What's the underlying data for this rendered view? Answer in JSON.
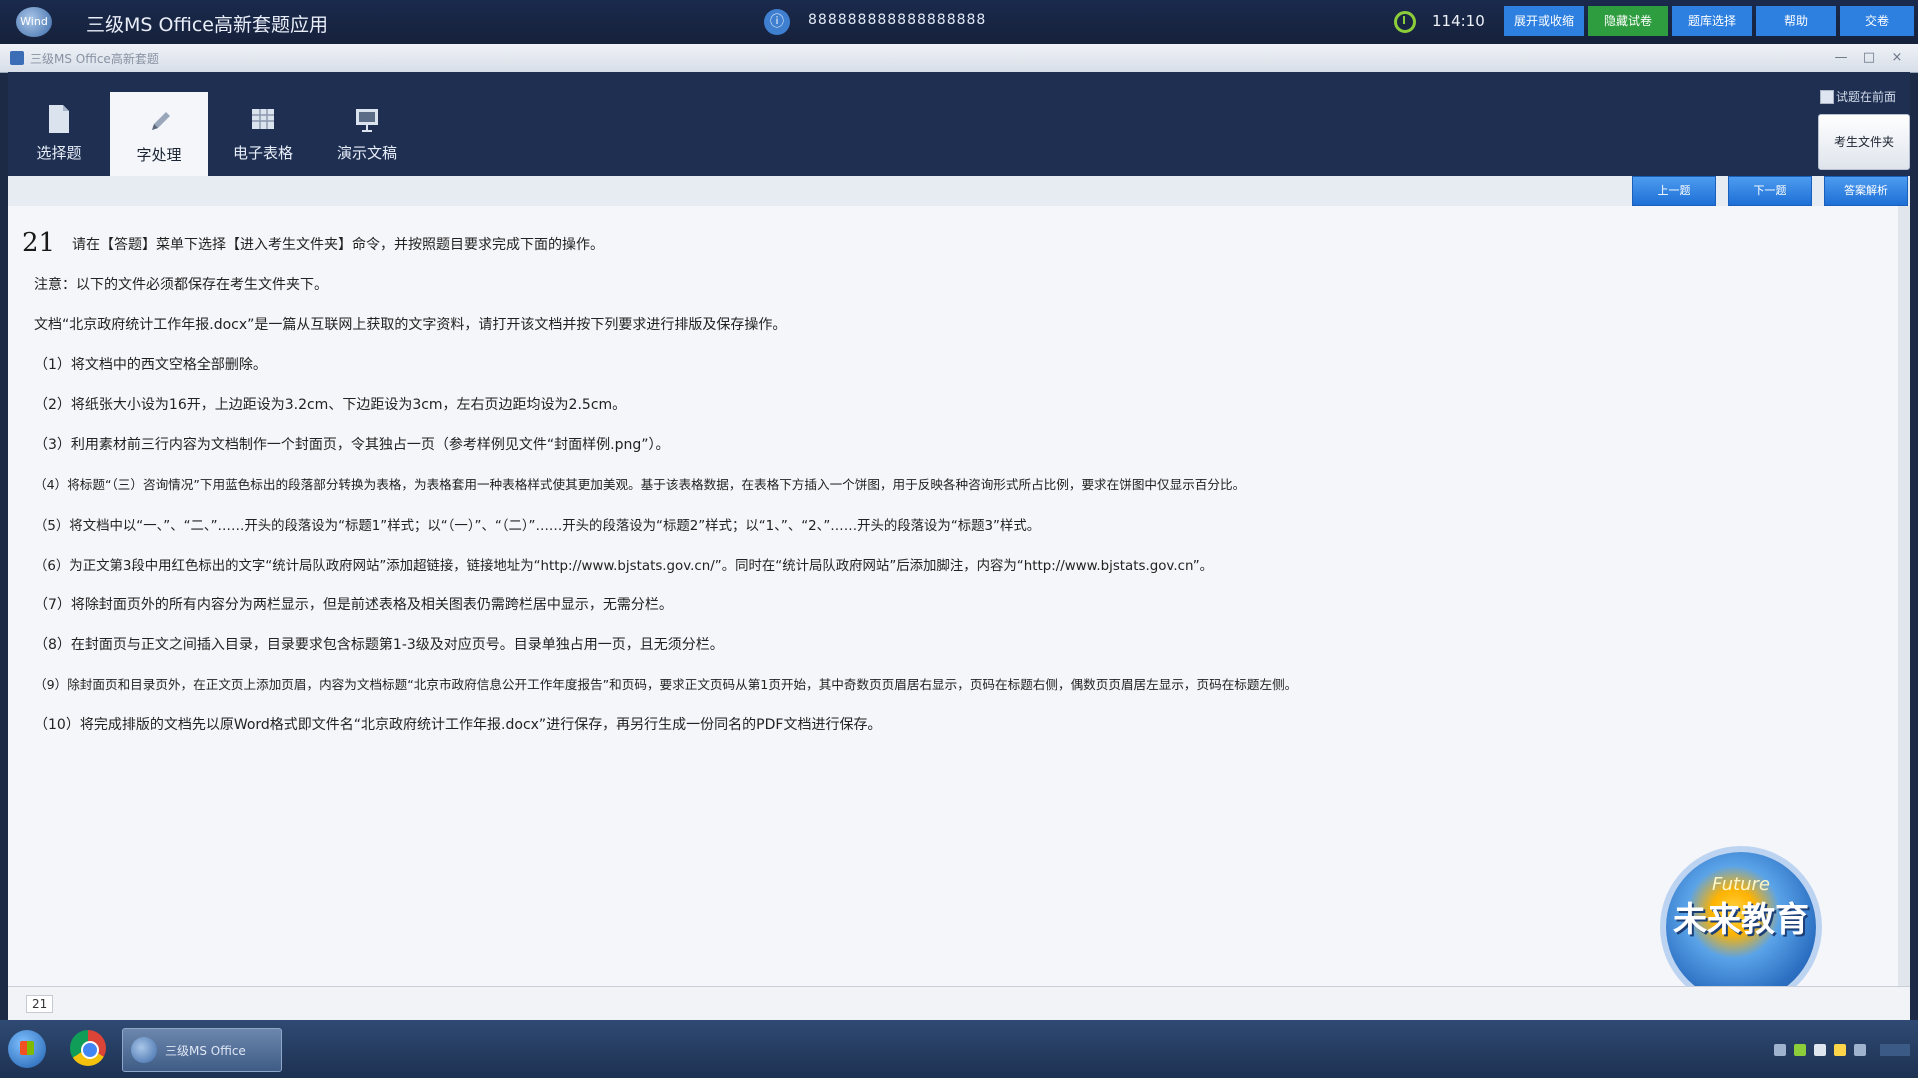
{
  "titlebar": {
    "app_title": "三级MS Office高新套题应用",
    "logo_text": "Wind",
    "exam_id_icon": "info-icon",
    "exam_id": "888888888888888888",
    "timer": "114:10",
    "buttons": [
      {
        "label": "展开或收缩",
        "color": "#2d7fe0"
      },
      {
        "label": "隐藏试卷",
        "color": "#2e9d3f"
      },
      {
        "label": "题库选择",
        "color": "#2d7fe0"
      },
      {
        "label": "帮助",
        "color": "#2d7fe0"
      },
      {
        "label": "交卷",
        "color": "#2d7fe0"
      }
    ]
  },
  "subwindow": {
    "title": "三级MS Office高新套题",
    "controls": [
      "—",
      "□",
      "×"
    ]
  },
  "ribbon": {
    "tabs": [
      {
        "label": "选择题",
        "icon": "document-icon",
        "active": false
      },
      {
        "label": "字处理",
        "icon": "pen-icon",
        "active": true
      },
      {
        "label": "电子表格",
        "icon": "spreadsheet-icon",
        "active": false
      },
      {
        "label": "演示文稿",
        "icon": "presentation-icon",
        "active": false
      }
    ],
    "checkbox_label": "试题在前面",
    "candidate_folder_button": "考生文件夹"
  },
  "toolbar": {
    "buttons": [
      "上一题",
      "下一题",
      "答案解析"
    ],
    "accent": "#1d6fd6"
  },
  "question": {
    "number": "21",
    "lines": [
      "请在【答题】菜单下选择【进入考生文件夹】命令，并按照题目要求完成下面的操作。",
      "注意：以下的文件必须都保存在考生文件夹下。",
      "文档“北京政府统计工作年报.docx”是一篇从互联网上获取的文字资料，请打开该文档并按下列要求进行排版及保存操作。",
      "（1）将文档中的西文空格全部删除。",
      "（2）将纸张大小设为16开，上边距设为3.2cm、下边距设为3cm，左右页边距均设为2.5cm。",
      "（3）利用素材前三行内容为文档制作一个封面页，令其独占一页（参考样例见文件“封面样例.png”）。",
      "（4）将标题“（三）咨询情况”下用蓝色标出的段落部分转换为表格，为表格套用一种表格样式使其更加美观。基于该表格数据，在表格下方插入一个饼图，用于反映各种咨询形式所占比例，要求在饼图中仅显示百分比。",
      "（5）将文档中以“一、”、“二、”……开头的段落设为“标题1”样式；以“（一）”、“（二）”……开头的段落设为“标题2”样式；以“1、”、“2、”……开头的段落设为“标题3”样式。",
      "（6）为正文第3段中用红色标出的文字“统计局队政府网站”添加超链接，链接地址为“http://www.bjstats.gov.cn/”。同时在“统计局队政府网站”后添加脚注，内容为“http://www.bjstats.gov.cn”。",
      "（7）将除封面页外的所有内容分为两栏显示，但是前述表格及相关图表仍需跨栏居中显示，无需分栏。",
      "（8）在封面页与正文之间插入目录，目录要求包含标题第1-3级及对应页号。目录单独占用一页，且无须分栏。",
      "（9）除封面页和目录页外，在正文页上添加页眉，内容为文档标题“北京市政府信息公开工作年度报告”和页码，要求正文页码从第1页开始，其中奇数页页眉居右显示，页码在标题右侧，偶数页页眉居左显示，页码在标题左侧。",
      "（10）将完成排版的文档先以原Word格式即文件名“北京政府统计工作年报.docx”进行保存，再另行生成一份同名的PDF文档进行保存。"
    ]
  },
  "mascot": {
    "text": "未来教育",
    "subtext": "Future"
  },
  "status": {
    "page_counter": "21"
  },
  "taskbar": {
    "start_icon": "windows-start-icon",
    "browser_icon": "chrome-icon",
    "app_label": "三级MS Office",
    "tray_colors": [
      "#9fb3cf",
      "#8ccd3a",
      "#e0e6ef",
      "#ffd54a",
      "#9fb3cf"
    ]
  }
}
